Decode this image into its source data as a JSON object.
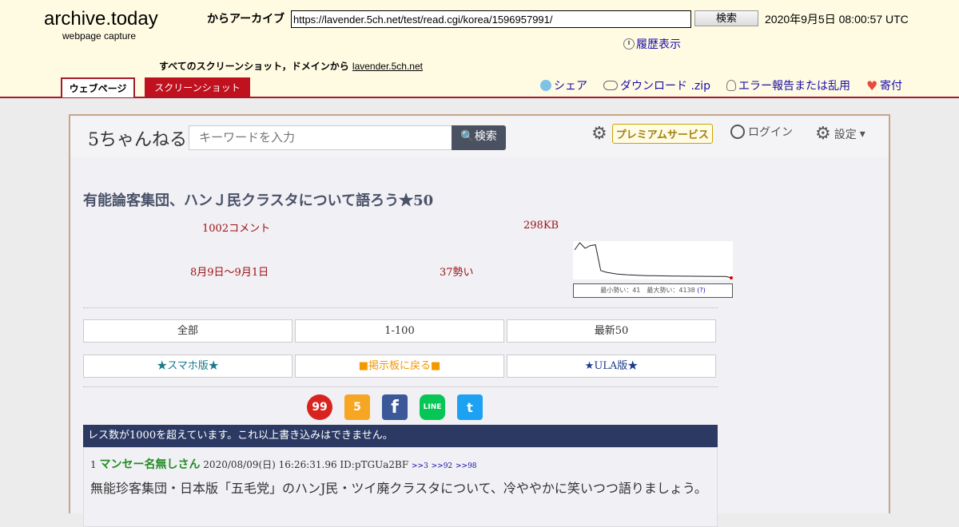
{
  "archive": {
    "title": "archive.today",
    "subtitle": "webpage capture",
    "archive_label": "からアーカイブ",
    "url": "https://lavender.5ch.net/test/read.cgi/korea/1596957991/",
    "search_button": "検索",
    "capture_date": "2020年9月5日 08:00:57 UTC",
    "history_link": "履歴表示",
    "all_screenshots_prefix": "すべてのスクリーンショット，ドメインから",
    "domain_link": "lavender.5ch.net",
    "tabs": [
      {
        "label": "ウェブページ",
        "active": true
      },
      {
        "label": "スクリーンショット",
        "active": false
      }
    ],
    "links": {
      "share": "シェア",
      "download": "ダウンロード .zip",
      "report": "エラー報告または乱用",
      "donate": "寄付"
    }
  },
  "site": {
    "logo": "5ちゃんねる",
    "search_placeholder": "キーワードを入力",
    "search_button": "検索",
    "premium": "プレミアムサービス",
    "login": "ログイン",
    "settings": "設定"
  },
  "thread": {
    "title": "有能論客集団、ハンＪ民クラスタについて語ろう★50",
    "comments": "1002コメント",
    "size": "298KB",
    "period": "8月9日〜9月1日",
    "momentum": "37勢い",
    "graph_caption": "最小勢い：41　最大勢い：4138",
    "graph_help": "(?)",
    "nav": [
      "全部",
      "1-100",
      "最新50"
    ],
    "links": [
      "★スマホ版★",
      "■掲示板に戻る■",
      "★ULA版★"
    ],
    "social": [
      "99",
      "5",
      "f",
      "LINE",
      "t"
    ],
    "notice": "レス数が1000を超えています。これ以上書き込みはできません。",
    "post": {
      "number": "1",
      "name": "マンセー名無しさん",
      "date": "2020/08/09(日) 16:26:31.96 ID:pTGUa2BF",
      "refs": [
        ">>3",
        ">>92",
        ">>98"
      ],
      "body": "無能珍客集団・日本版「五毛党」のハンJ民・ツイ廃クラスタについて、冷ややかに笑いつつ語りましょう。"
    }
  },
  "chart_data": {
    "type": "line",
    "title": "",
    "xlabel": "",
    "ylabel": "",
    "ylim": [
      41,
      4138
    ],
    "values": [
      3300,
      4138,
      3500,
      3800,
      3900,
      900,
      700,
      600,
      500,
      450,
      400,
      380,
      350,
      320,
      300,
      290,
      280,
      270,
      260,
      250,
      245,
      240,
      235,
      230,
      225,
      220,
      215,
      210,
      205,
      200,
      41
    ],
    "colors": {
      "line": "#222222",
      "end_point": "#d00000"
    }
  }
}
